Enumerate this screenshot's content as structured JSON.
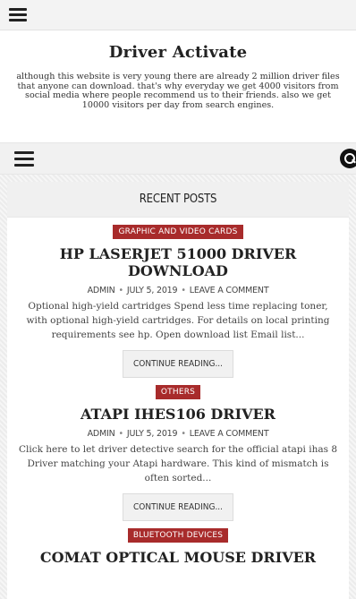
{
  "topbar": {
    "menu_icon": "hamburger-menu-icon"
  },
  "site": {
    "title": "Driver Activate",
    "description": "although this website is very young there are already 2 million driver files that anyone can download. that's why everyday we get 4000 visitors from social media where people recommend us to their friends. also we get 10000 visitors per day from search engines."
  },
  "navbar": {
    "menu_icon": "hamburger-menu-icon",
    "search_icon": "search-icon"
  },
  "recent_posts": {
    "heading": "RECENT POSTS",
    "posts": [
      {
        "category": "GRAPHIC AND VIDEO CARDS",
        "title": "HP LASERJET 51000 DRIVER DOWNLOAD",
        "author": "ADMIN",
        "date": "JULY 5, 2019",
        "comment_link": "LEAVE A COMMENT",
        "excerpt": "Optional high-yield cartridges Spend less time replacing toner, with optional high-yield cartridges. For details on local printing requirements see hp. Open download list Email list...",
        "more_label": "CONTINUE READING..."
      },
      {
        "category": "OTHERS",
        "title": "ATAPI IHES106 DRIVER",
        "author": "ADMIN",
        "date": "JULY 5, 2019",
        "comment_link": "LEAVE A COMMENT",
        "excerpt": "Click here to let driver detective search for the official atapi ihas 8 Driver matching your Atapi hardware. This kind of mismatch is often sorted...",
        "more_label": "CONTINUE READING..."
      },
      {
        "category": "BLUETOOTH DEVICES",
        "title": "COMAT OPTICAL MOUSE DRIVER"
      }
    ]
  },
  "colors": {
    "category_badge": "#a82b2b",
    "bar_bg": "#f3f3f3"
  }
}
